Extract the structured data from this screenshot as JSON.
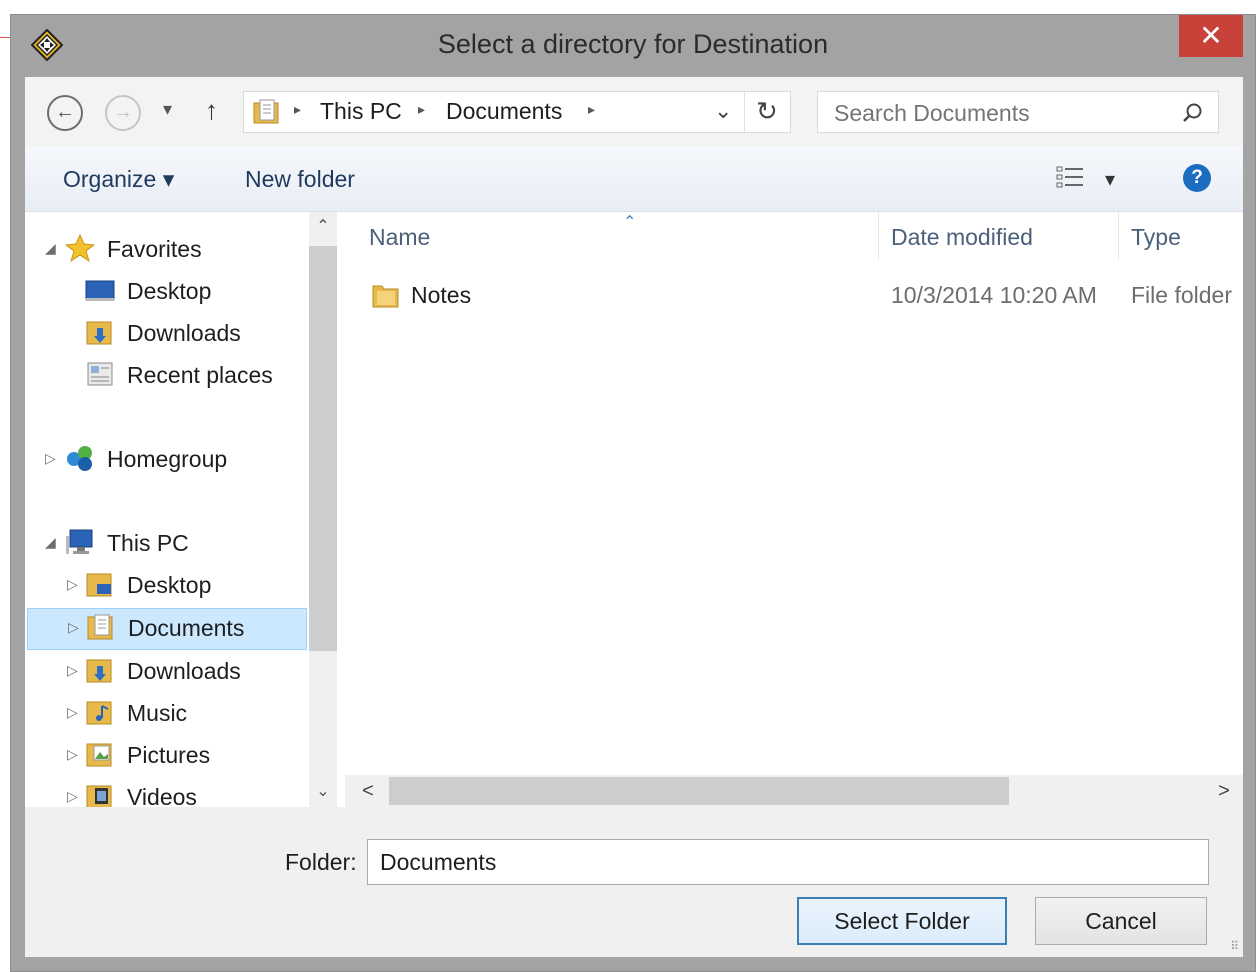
{
  "window": {
    "title": "Select a directory for Destination",
    "close_label": "✕"
  },
  "nav": {
    "back_glyph": "←",
    "forward_glyph": "→",
    "dropdown_glyph": "▾",
    "up_glyph": "↑",
    "breadcrumb": [
      "This PC",
      "Documents"
    ],
    "separator_glyph": "▸",
    "address_dropdown_glyph": "⌄",
    "refresh_glyph": "↻",
    "search_placeholder": "Search Documents"
  },
  "toolbar": {
    "organize_label": "Organize ▾",
    "new_folder_label": "New folder",
    "view_glyph": "▾",
    "help_glyph": "?"
  },
  "navpane": {
    "favorites": {
      "label": "Favorites",
      "items": [
        "Desktop",
        "Downloads",
        "Recent places"
      ]
    },
    "homegroup": {
      "label": "Homegroup"
    },
    "this_pc": {
      "label": "This PC",
      "items": [
        "Desktop",
        "Documents",
        "Downloads",
        "Music",
        "Pictures",
        "Videos"
      ]
    },
    "selected": "Documents",
    "expanded_arrow": "◢",
    "collapsed_arrow": "▷",
    "scroll_up": "⌃",
    "scroll_down": "⌄"
  },
  "filelist": {
    "columns": [
      "Name",
      "Date modified",
      "Type"
    ],
    "sort_indicator": "⌃",
    "rows": [
      {
        "name": "Notes",
        "date_modified": "10/3/2014 10:20 AM",
        "type": "File folder"
      }
    ],
    "scroll_left": "<",
    "scroll_right": ">"
  },
  "bottom": {
    "folder_label": "Folder:",
    "folder_value": "Documents",
    "select_button": "Select Folder",
    "cancel_button": "Cancel"
  },
  "colors": {
    "close_red": "#c8423a",
    "selection": "#cce8ff",
    "link_blue": "#1e3a5f",
    "default_button_border": "#3c7fb1"
  }
}
